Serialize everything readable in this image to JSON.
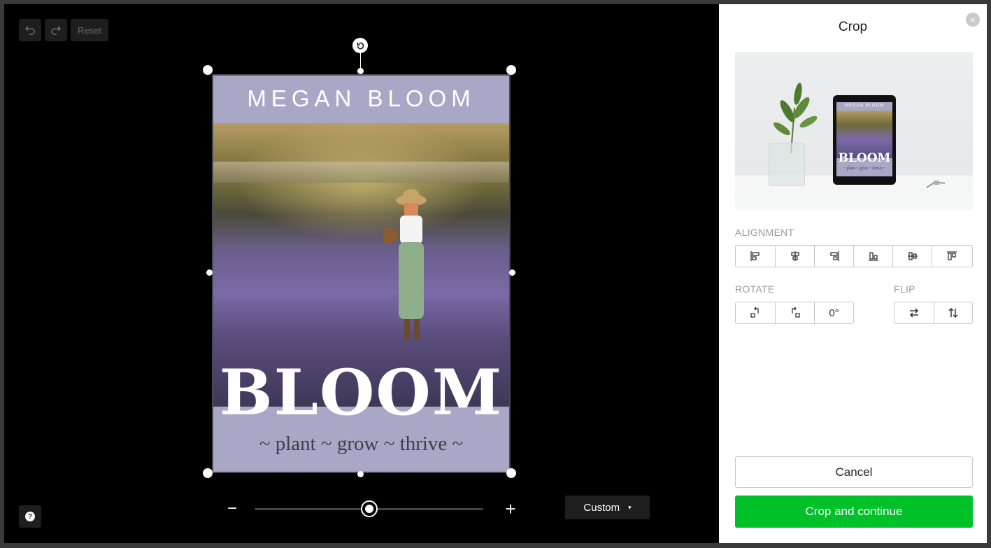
{
  "toolbar": {
    "undo_icon": "undo-icon",
    "redo_icon": "redo-icon",
    "reset_label": "Reset"
  },
  "cover": {
    "author": "MEGAN BLOOM",
    "title": "BLOOM",
    "tagline": "~ plant ~ grow ~ thrive ~",
    "band_color": "#a9a7c6"
  },
  "zoom": {
    "minus_label": "−",
    "plus_label": "+",
    "level": 0.5
  },
  "aspect": {
    "selected": "Custom",
    "caret": "▾"
  },
  "help": {
    "label": "?"
  },
  "panel": {
    "title": "Crop",
    "close_label": "×",
    "preview_tablet": {
      "author": "MEGAN BLOOM",
      "title": "BLOOM",
      "tagline": "~ plant ~ grow ~ thrive ~"
    },
    "alignment_label": "ALIGNMENT",
    "alignment_buttons": [
      "align-left-icon",
      "align-center-horizontal-icon",
      "align-right-icon",
      "align-bottom-icon",
      "align-center-vertical-icon",
      "align-top-icon"
    ],
    "rotate_label": "ROTATE",
    "rotate_buttons": [
      "rotate-left-icon",
      "rotate-right-icon"
    ],
    "rotate_angle": "0°",
    "flip_label": "FLIP",
    "flip_buttons": [
      "flip-horizontal-icon",
      "flip-vertical-icon"
    ],
    "cancel_label": "Cancel",
    "confirm_label": "Crop and continue",
    "confirm_color": "#00c12a"
  }
}
